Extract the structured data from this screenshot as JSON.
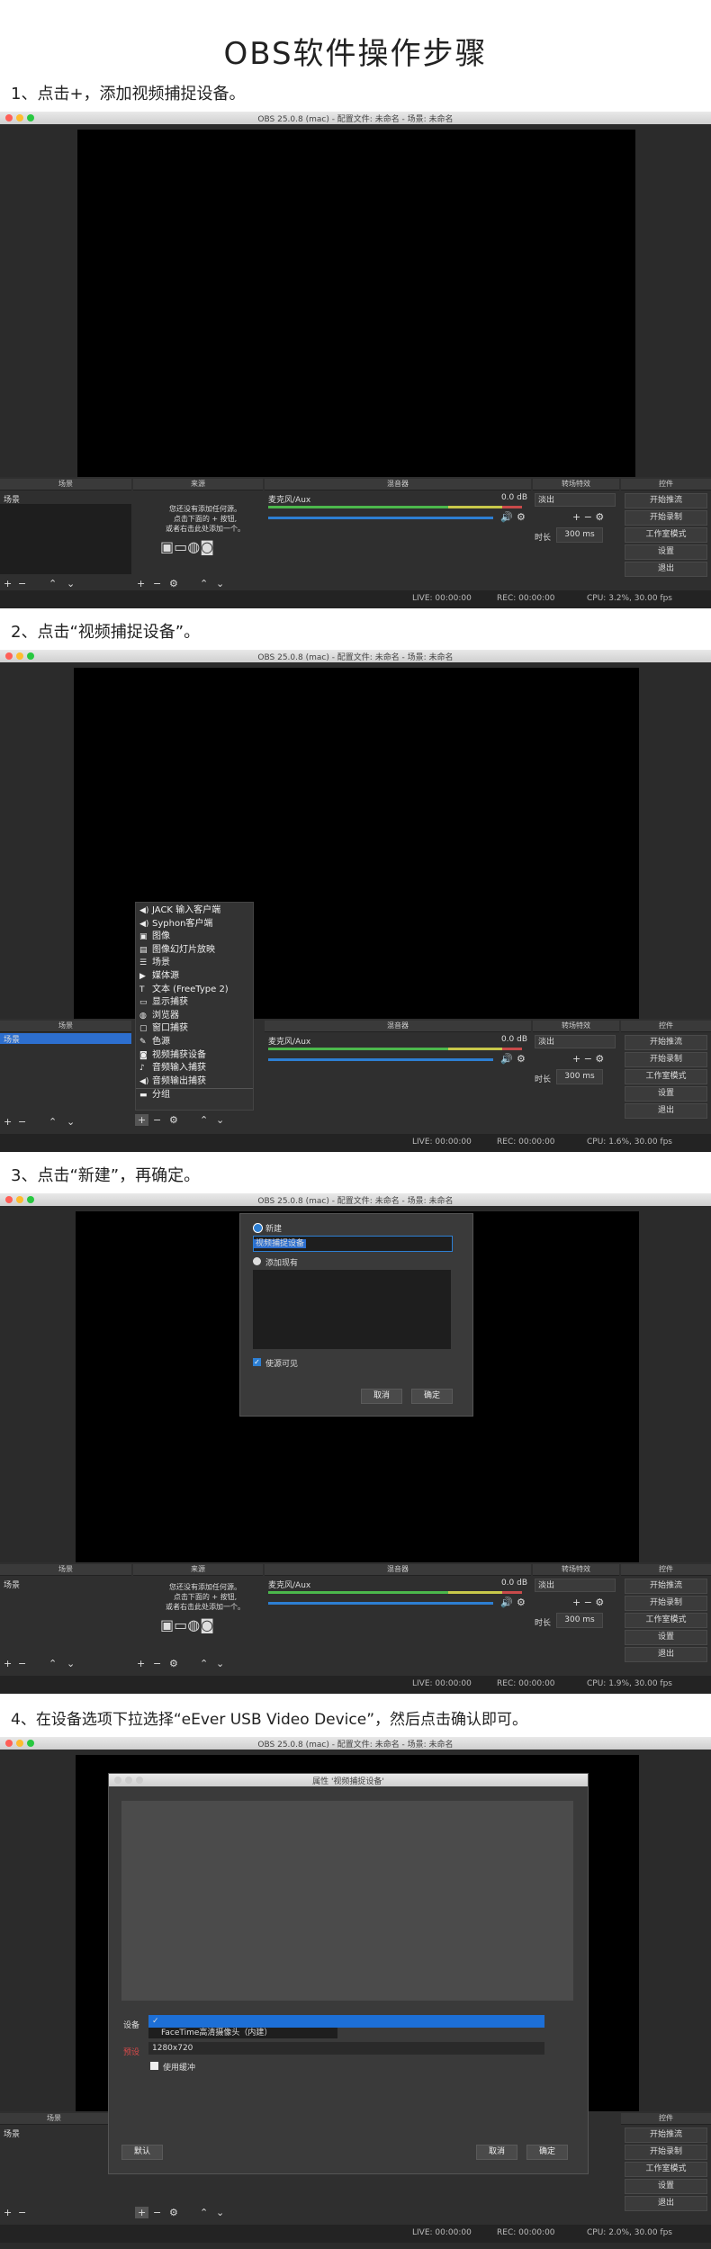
{
  "title": "OBS软件操作步骤",
  "steps": [
    "1、点击+，添加视频捕捉设备。",
    "2、点击“视频捕捉设备”。",
    "3、点击“新建”，再确定。",
    "4、在设备选项下拉选择“eEver USB Video Device”，然后点击确认即可。"
  ],
  "window_title": "OBS 25.0.8 (mac) - 配置文件: 未命名 - 场景: 未命名",
  "docks": {
    "scenes": "场景",
    "sources": "来源",
    "mixer": "混音器",
    "transitions": "转场特效",
    "controls": "控件"
  },
  "scene_item": "场景",
  "sources_empty": [
    "您还没有添加任何源。",
    "点击下面的 + 按钮,",
    "或者右击此处添加一个。"
  ],
  "mixer": {
    "channel": "麦克风/Aux",
    "db": "0.0 dB"
  },
  "transitions": {
    "fade": "淡出",
    "duration_label": "时长",
    "duration": "300 ms"
  },
  "controls": [
    "开始推流",
    "开始录制",
    "工作室模式",
    "设置",
    "退出"
  ],
  "status": {
    "live": "LIVE: 00:00:00",
    "rec": "REC: 00:00:00",
    "cpu1": "CPU: 3.2%, 30.00 fps",
    "cpu2": "CPU: 1.6%, 30.00 fps",
    "cpu3": "CPU: 1.9%, 30.00 fps",
    "cpu4": "CPU: 2.0%, 30.00 fps"
  },
  "source_menu": [
    {
      "icon": "audio-icon",
      "label": "JACK 输入客户端"
    },
    {
      "icon": "audio-icon",
      "label": "Syphon客户端"
    },
    {
      "icon": "image-icon",
      "label": "图像"
    },
    {
      "icon": "slideshow-icon",
      "label": "图像幻灯片放映"
    },
    {
      "icon": "list-icon",
      "label": "场景"
    },
    {
      "icon": "play-icon",
      "label": "媒体源"
    },
    {
      "icon": "text-icon",
      "label": "文本 (FreeType 2)"
    },
    {
      "icon": "monitor-icon",
      "label": "显示捕获"
    },
    {
      "icon": "globe-icon",
      "label": "浏览器"
    },
    {
      "icon": "window-icon",
      "label": "窗口捕获"
    },
    {
      "icon": "brush-icon",
      "label": "色源"
    },
    {
      "icon": "camera-icon",
      "label": "视频捕获设备"
    },
    {
      "icon": "mic-icon",
      "label": "音频输入捕获"
    },
    {
      "icon": "speaker-icon",
      "label": "音频输出捕获"
    },
    {
      "icon": "folder-icon",
      "label": "分组"
    }
  ],
  "create_dialog": {
    "new_label": "新建",
    "name_value": "视频捕捉设备",
    "existing_label": "添加现有",
    "visible_label": "使源可见",
    "cancel": "取消",
    "ok": "确定"
  },
  "props_dialog": {
    "title": "属性 '视频捕捉设备'",
    "device_label": "设备",
    "device_option": "FaceTime高清摄像头（内建）",
    "preset_label": "预设",
    "preset_value": "1280x720",
    "buffer_label": "使用缓冲",
    "defaults": "默认",
    "cancel": "取消",
    "ok": "确定"
  }
}
